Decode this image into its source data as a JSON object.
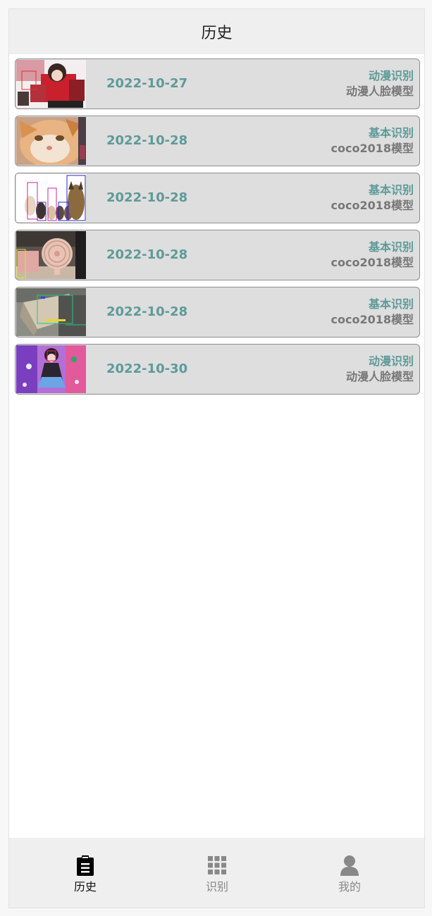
{
  "header": {
    "title": "历史"
  },
  "history": [
    {
      "date": "2022-10-27",
      "mode": "动漫识别",
      "model": "动漫人脸模型",
      "thumbnail": "anime-girl-red"
    },
    {
      "date": "2022-10-28",
      "mode": "基本识别",
      "model": "coco2018模型",
      "thumbnail": "cat-face"
    },
    {
      "date": "2022-10-28",
      "mode": "基本识别",
      "model": "coco2018模型",
      "thumbnail": "cats-and-dog"
    },
    {
      "date": "2022-10-28",
      "mode": "基本识别",
      "model": "coco2018模型",
      "thumbnail": "fan-on-desk"
    },
    {
      "date": "2022-10-28",
      "mode": "基本识别",
      "model": "coco2018模型",
      "thumbnail": "cardboard-box"
    },
    {
      "date": "2022-10-30",
      "mode": "动漫识别",
      "model": "动漫人脸模型",
      "thumbnail": "anime-girl-purple"
    }
  ],
  "tabbar": {
    "items": [
      {
        "label": "历史",
        "icon": "clipboard-icon",
        "active": true
      },
      {
        "label": "识别",
        "icon": "grid-icon",
        "active": false
      },
      {
        "label": "我的",
        "icon": "person-icon",
        "active": false
      }
    ]
  },
  "colors": {
    "accent": "#5e9a98",
    "muted": "#777777",
    "card_bg": "#dedede",
    "header_bg": "#efefef"
  }
}
